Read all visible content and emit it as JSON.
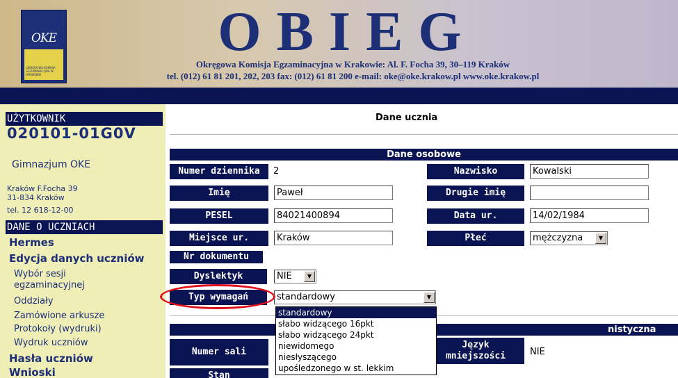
{
  "header": {
    "logo_text": "OKE",
    "logo_caption": "OKRĘGOWA KOMISJA EGZAMINACYJNA W KRAKOWIE",
    "title": "OBIEG",
    "subtitle_line1": "Okręgowa Komisja Egzaminacyjna w Krakowie: Al. F. Focha 39, 30–119 Kraków",
    "subtitle_line2": "tel. (012) 61 81 201, 202, 203  fax: (012) 61 81 200  e-mail: oke@oke.krakow.pl   www.oke.krakow.pl"
  },
  "sidebar": {
    "user_header": "UŻYTKOWNIK",
    "user_id": "020101-01G0V",
    "school_name": "Gimnazjum OKE",
    "address_line1": "Kraków F.Focha 39",
    "address_line2": "31-834 Kraków",
    "address_line3": "tel. 12 618-12-00",
    "data_header": "DANE O UCZNIACH",
    "items": {
      "hermes": "Hermes",
      "edycja": "Edycja danych uczniów",
      "wybor_sesji_1": "Wybór sesji",
      "wybor_sesji_2": "egzaminacyjnej",
      "oddzialy": "Oddziały",
      "zamowione": "Zamówione arkusze",
      "protokoly": "Protokoły (wydruki)",
      "wydruk": "Wydruk uczniów",
      "hasla": "Hasła uczniów",
      "wnioski": "Wnioski"
    }
  },
  "main": {
    "title": "Dane ucznia",
    "personal_header": "Dane osobowe",
    "second_header_visible_text": "nistyczna",
    "fields": {
      "numer_dziennika": {
        "label": "Numer dziennika",
        "value": "2"
      },
      "nazwisko": {
        "label": "Nazwisko",
        "value": "Kowalski"
      },
      "imie": {
        "label": "Imię",
        "value": "Paweł"
      },
      "drugie_imie": {
        "label": "Drugie imię",
        "value": ""
      },
      "pesel": {
        "label": "PESEL",
        "value": "84021400894"
      },
      "data_ur": {
        "label": "Data ur.",
        "value": "14/02/1984"
      },
      "miejsce_ur": {
        "label": "Miejsce ur.",
        "value": "Kraków"
      },
      "plec": {
        "label": "Płeć",
        "value": "mężczyzna"
      },
      "nr_dokumentu": {
        "label": "Nr dokumentu"
      },
      "dyslektyk": {
        "label": "Dyslektyk",
        "value": "NIE"
      },
      "typ_wymagan": {
        "label": "Typ wymagań",
        "value": "standardowy"
      },
      "numer_sali": {
        "label": "Numer sali"
      },
      "jezyk_1": "Język",
      "jezyk_2": "mniejszości",
      "jezyk_value": "NIE",
      "stan": {
        "label": "Stan"
      }
    },
    "dropdown_options": [
      "standardowy",
      "słabo widzącego 16pkt",
      "słabo widzącego 24pkt",
      "niewidomego",
      "niesłyszącego",
      "upośledzonego w st. lekkim"
    ]
  },
  "colors": {
    "navy": "#0a1452",
    "sidebar_bg": "#f0eeb7",
    "highlight_oval": "#e0101a"
  }
}
